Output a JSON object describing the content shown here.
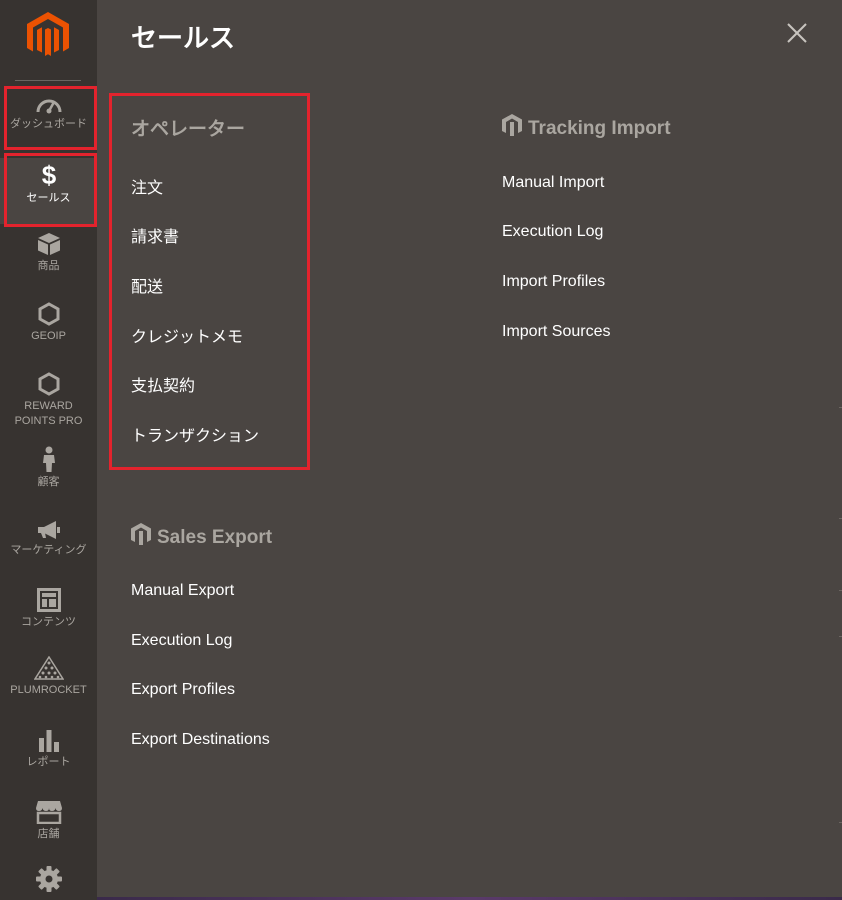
{
  "sidebar": {
    "items": [
      {
        "label": "ダッシュボード",
        "icon": "dashboard-icon"
      },
      {
        "label": "セールス",
        "icon": "dollar-icon"
      },
      {
        "label": "商品",
        "icon": "box-icon"
      },
      {
        "label": "GEOIP",
        "icon": "hexagon-icon"
      },
      {
        "label": "REWARD POINTS PRO",
        "icon": "hexagon-icon"
      },
      {
        "label": "顧客",
        "icon": "person-icon"
      },
      {
        "label": "マーケティング",
        "icon": "megaphone-icon"
      },
      {
        "label": "コンテンツ",
        "icon": "layout-icon"
      },
      {
        "label": "PLUMROCKET",
        "icon": "plumrocket-icon"
      },
      {
        "label": "レポート",
        "icon": "bar-chart-icon"
      },
      {
        "label": "店舗",
        "icon": "store-icon"
      },
      {
        "label": "",
        "icon": "gear-icon"
      }
    ]
  },
  "panel": {
    "title": "セールス",
    "sections": {
      "operations": {
        "title": "オペレーター",
        "links": [
          "注文",
          "請求書",
          "配送",
          "クレジットメモ",
          "支払契約",
          "トランザクション"
        ]
      },
      "tracking_import": {
        "title": "Tracking Import",
        "links": [
          "Manual Import",
          "Execution Log",
          "Import Profiles",
          "Import Sources"
        ]
      },
      "sales_export": {
        "title": "Sales Export",
        "links": [
          "Manual Export",
          "Execution Log",
          "Export Profiles",
          "Export Destinations"
        ]
      }
    }
  },
  "colors": {
    "sidebar_bg": "#373330",
    "panel_bg": "#4a4542",
    "highlight": "#e3232d",
    "brand_orange": "#eb5202",
    "muted_text": "#aaa6a0"
  }
}
